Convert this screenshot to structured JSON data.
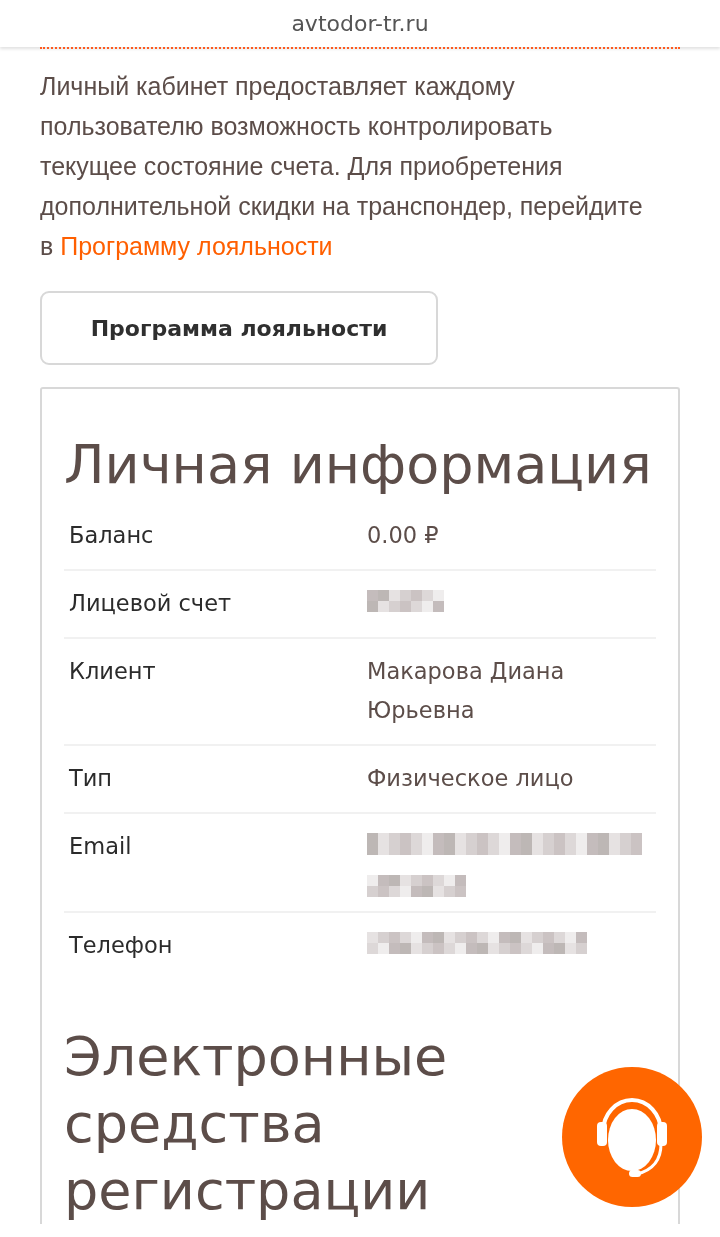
{
  "browser": {
    "url": "avtodor-tr.ru"
  },
  "intro": {
    "text": "Личный кабинет предоставляет каждому пользователю возможность контролировать текущее состояние счета. Для приобретения дополнительной скидки на транспондер, перейдите в ",
    "link": "Программу лояльности"
  },
  "loyalty_button": "Программа лояльности",
  "personal_info": {
    "title": "Личная информация",
    "rows": [
      {
        "label": "Баланс",
        "kind": "text",
        "value": "0.00 ₽"
      },
      {
        "label": "Лицевой счет",
        "kind": "blurred"
      },
      {
        "label": "Клиент",
        "kind": "text",
        "value": "Макарова Диана Юрьевна"
      },
      {
        "label": "Тип",
        "kind": "text",
        "value": "Физическое лицо"
      },
      {
        "label": "Email",
        "kind": "blurred"
      },
      {
        "label": "Телефон",
        "kind": "blurred"
      }
    ]
  },
  "devices": {
    "title": "Электронные средства регистрации"
  }
}
